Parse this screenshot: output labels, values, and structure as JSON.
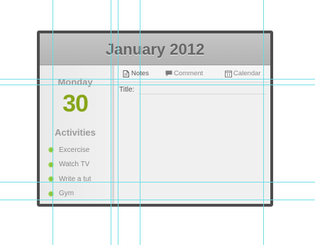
{
  "header": {
    "title": "January 2012"
  },
  "day": {
    "weekday": "Monday",
    "number": "30"
  },
  "activities": {
    "title": "Activities",
    "items": [
      "Excercise",
      "Watch TV",
      "Write a tut",
      "Gym"
    ]
  },
  "tabs": [
    {
      "label": "Notes",
      "icon": "notes-icon"
    },
    {
      "label": "Comment",
      "icon": "comment-icon"
    },
    {
      "label": "Calendar",
      "icon": "calendar-icon"
    }
  ],
  "form": {
    "title_label": "Title:",
    "title_value": ""
  },
  "colors": {
    "accent_green": "#87a619",
    "bullet_green": "#8cc63f",
    "guide_cyan": "#64dbe3",
    "frame": "#4d4d4d"
  }
}
